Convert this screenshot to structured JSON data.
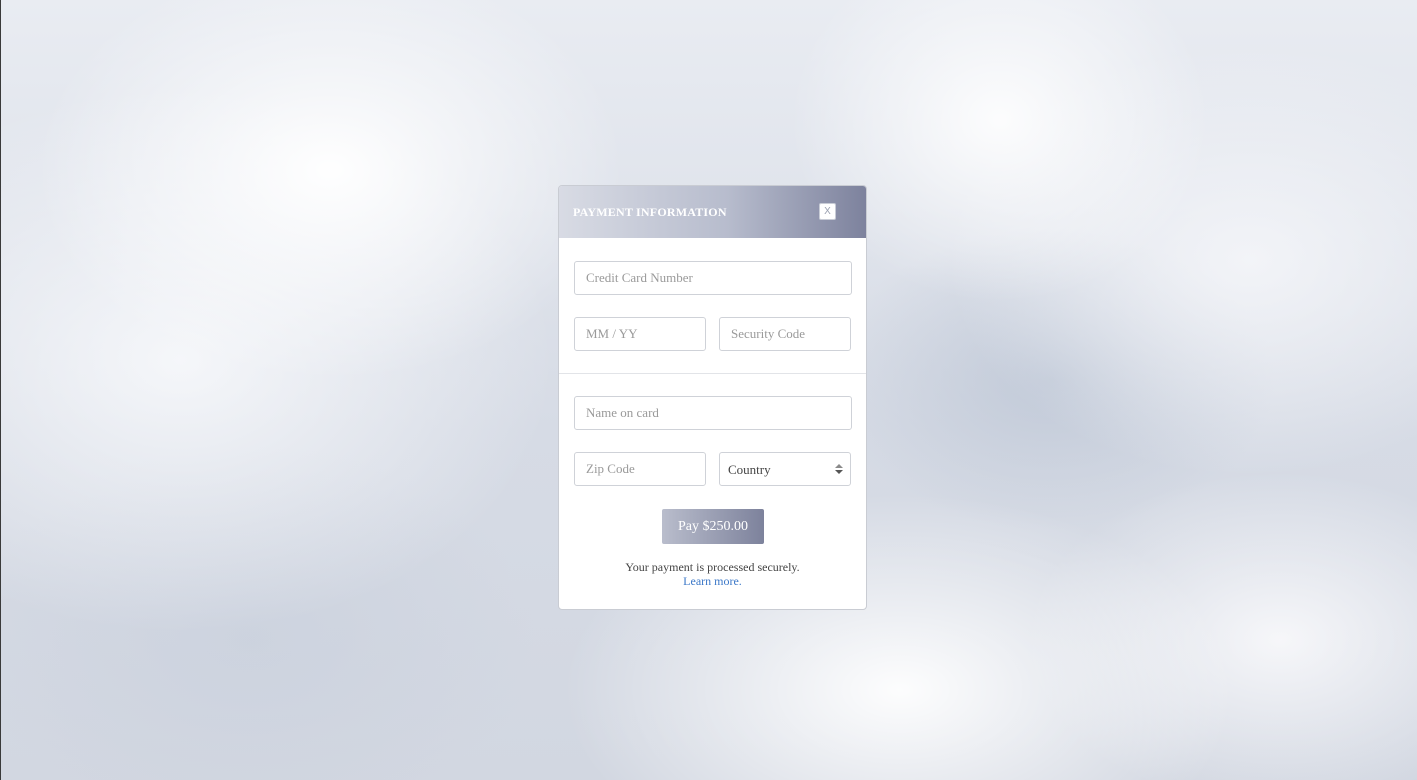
{
  "modal": {
    "title": "PAYMENT INFORMATION",
    "close_label": "X"
  },
  "form": {
    "card_number_placeholder": "Credit Card Number",
    "expiry_placeholder": "MM / YY",
    "security_code_placeholder": "Security Code",
    "name_placeholder": "Name on card",
    "zip_placeholder": "Zip Code",
    "country_selected": "Country"
  },
  "actions": {
    "pay_label": "Pay $250.00"
  },
  "footer": {
    "secure_text": "Your payment is processed securely.",
    "learn_more": "Learn more."
  },
  "colors": {
    "header_gradient_start": "#d8dbe4",
    "header_gradient_end": "#7d829d",
    "link": "#3c78c8"
  }
}
